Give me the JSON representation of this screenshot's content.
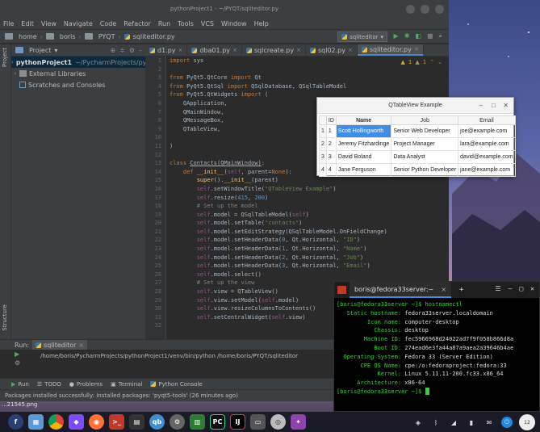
{
  "pycharm": {
    "window_title": "pythonProject1 - ~/PYQT/sqliteditor.py",
    "menu": [
      "File",
      "Edit",
      "View",
      "Navigate",
      "Code",
      "Refactor",
      "Run",
      "Tools",
      "VCS",
      "Window",
      "Help"
    ],
    "breadcrumb": [
      "home",
      "boris",
      "PYQT",
      "sqliteditor.py"
    ],
    "run_config": "sqliteditor",
    "tabs": [
      {
        "label": "d1.py",
        "active": false
      },
      {
        "label": "dba01.py",
        "active": false
      },
      {
        "label": "sqlcreate.py",
        "active": false
      },
      {
        "label": "sql02.py",
        "active": false
      },
      {
        "label": "sqliteditor.py",
        "active": true
      }
    ],
    "inspection": {
      "warnings": "1",
      "weak": "1"
    },
    "project_panel": {
      "title": "Project",
      "tree": [
        {
          "label": "pythonProject1",
          "path": "~/PycharmProjects/pyth"
        },
        {
          "label": "External Libraries"
        },
        {
          "label": "Scratches and Consoles"
        }
      ]
    },
    "left_strip": {
      "project": "Project",
      "structure": "Structure",
      "favorites": "Favorites"
    },
    "line_numbers": [
      "1",
      "2",
      "3",
      "4",
      "5",
      "6",
      "7",
      "8",
      "9",
      "10",
      "11",
      "12",
      "13",
      "14",
      "15",
      "16",
      "17",
      "18",
      "19",
      "20",
      "21",
      "22",
      "23",
      "24",
      "25",
      "26",
      "27",
      "28",
      "29",
      "30",
      "31",
      "32"
    ],
    "run_panel": {
      "label": "Run:",
      "tab": "sqliteditor",
      "command": "/home/boris/PycharmProjects/pythonProject1/venv/bin/python /home/boris/PYQT/sqliteditor"
    },
    "bottom_tabs": [
      "Run",
      "TODO",
      "Problems",
      "Terminal",
      "Python Console"
    ],
    "status": "Packages installed successfully: Installed packages: 'pyqt5-tools' (26 minutes ago)",
    "screenshot_name": "...21545.png"
  },
  "qt_dialog": {
    "title": "QTableView Example",
    "headers": [
      "ID",
      "Name",
      "Job",
      "Email"
    ],
    "rows": [
      {
        "vh": "1",
        "id": "1",
        "name": "Scott Hollingworth",
        "job": "Senior Web Developer",
        "email": "joe@example.com"
      },
      {
        "vh": "2",
        "id": "2",
        "name": "Jeremy Fitzhardinge",
        "job": "Project Manager",
        "email": "lara@example.com"
      },
      {
        "vh": "3",
        "id": "3",
        "name": "David  Boland",
        "job": "Data Analyst",
        "email": "david@example.com"
      },
      {
        "vh": "4",
        "id": "4",
        "name": "Jane  Ferguson",
        "job": "Senior Python Developer",
        "email": "jane@example.com"
      }
    ]
  },
  "terminal": {
    "tab_title": "boris@fedora33server:~",
    "prompt1": "[boris@fedora33server ~]$ hostnamectl",
    "info": [
      {
        "label": "   Static hostname:",
        "value": "fedora33server.localdomain"
      },
      {
        "label": "         Icon name:",
        "value": "computer-desktop"
      },
      {
        "label": "           Chassis:",
        "value": "desktop"
      },
      {
        "label": "        Machine ID:",
        "value": "fec5966968d24022ad7f9f058b866d8a"
      },
      {
        "label": "           Boot ID:",
        "value": "274ead6e3fa44a87a9aea2a39646b4ae"
      },
      {
        "label": "  Operating System:",
        "value": "Fedora 33 (Server Edition)"
      },
      {
        "label": "       CPE OS Name:",
        "value": "cpe:/o:fedoraproject:fedora:33"
      },
      {
        "label": "            Kernel:",
        "value": "Linux 5.11.11-200.fc33.x86_64"
      },
      {
        "label": "      Architecture:",
        "value": "x86-64"
      }
    ],
    "prompt2": "[boris@fedora33server ~]$ "
  },
  "taskbar": {
    "apps": [
      "fedora",
      "files",
      "chrome",
      "app",
      "firefox",
      "terminal",
      "vm",
      "qb",
      "settings",
      "app2",
      "pycharm",
      "intellij",
      "app3",
      "disk",
      "app4"
    ],
    "clock_label": "12"
  },
  "colors": {
    "accent": "#4a88c7",
    "selection": "#3d8ee6",
    "terminal_green": "#36d236"
  }
}
